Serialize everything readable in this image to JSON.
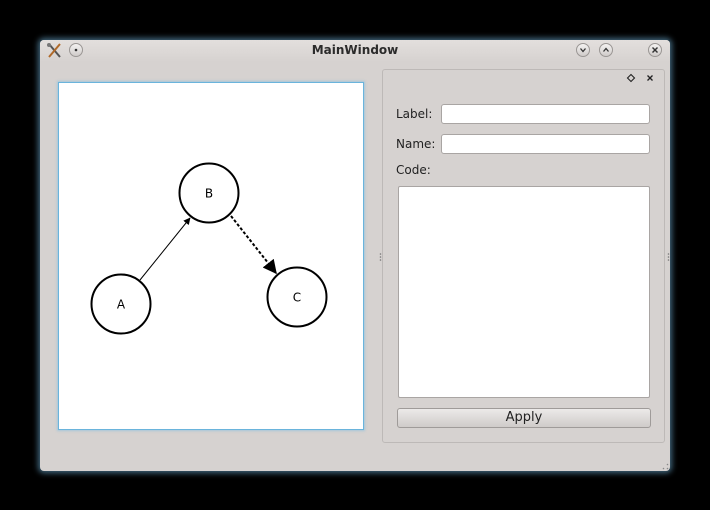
{
  "window": {
    "title": "MainWindow"
  },
  "graph": {
    "nodes": [
      {
        "label": "A"
      },
      {
        "label": "B"
      },
      {
        "label": "C"
      }
    ]
  },
  "panel": {
    "label_caption": "Label:",
    "label_value": "",
    "name_caption": "Name:",
    "name_value": "",
    "code_caption": "Code:",
    "code_value": "",
    "apply_label": "Apply"
  },
  "icons": {
    "app": "tools-icon",
    "window_menu": "menu-dot-icon",
    "minimize": "chevron-down-icon",
    "maximize": "chevron-up-icon",
    "close": "close-icon",
    "dock_float": "float-diamond-icon",
    "dock_close": "close-icon"
  },
  "colors": {
    "selection_border": "#6ab4dc",
    "window_bg": "#d6d2d0"
  }
}
